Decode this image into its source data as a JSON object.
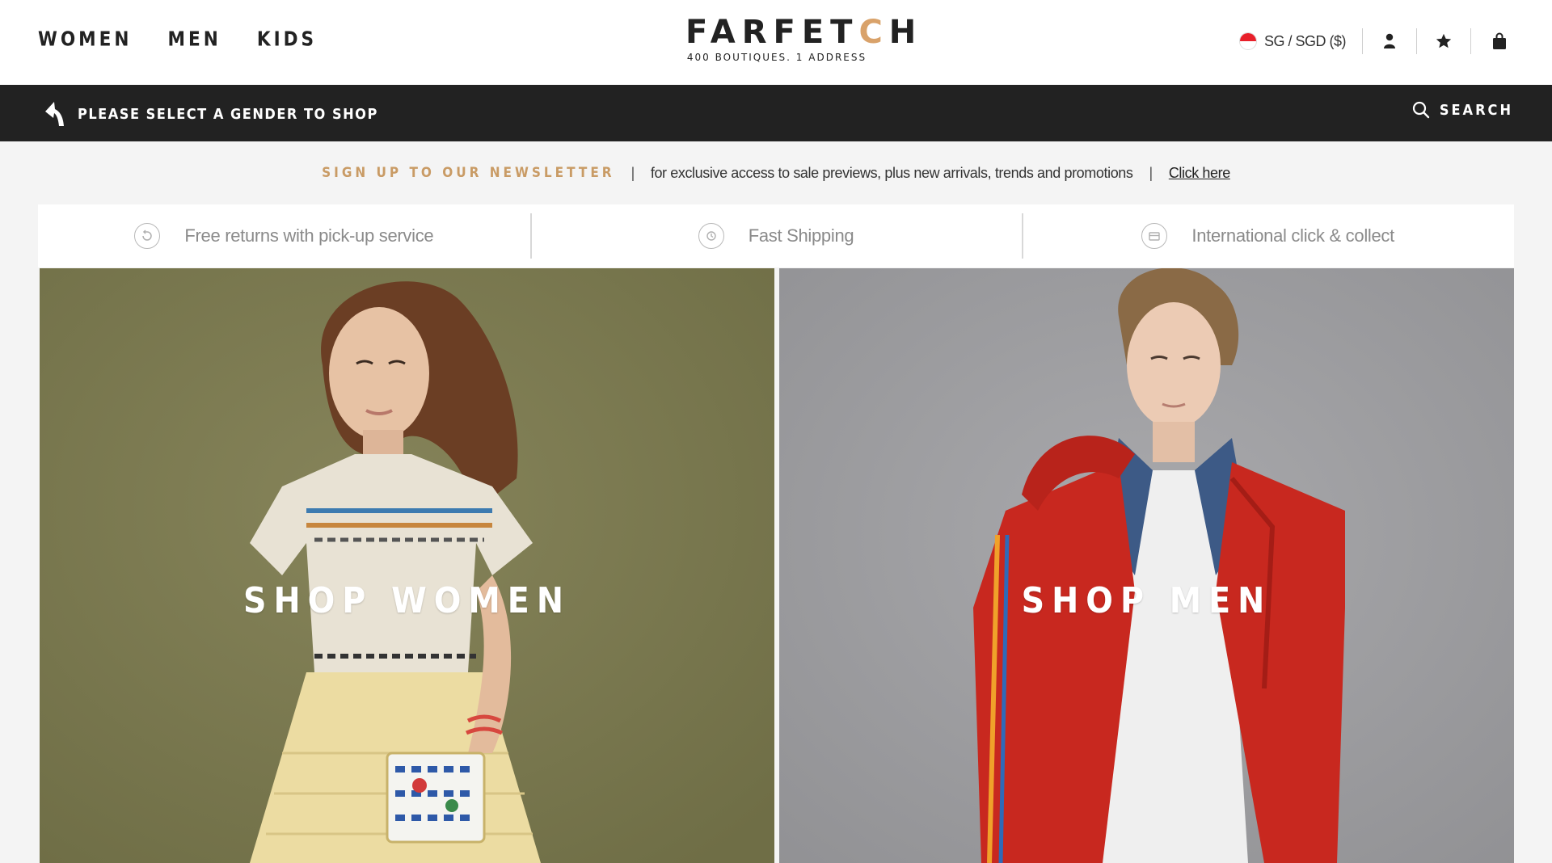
{
  "header": {
    "gender_nav": [
      "WOMEN",
      "MEN",
      "KIDS"
    ],
    "logo": {
      "wordmark_start": "FARFET",
      "wordmark_accent": "C",
      "wordmark_end": "H",
      "tagline": "400 BOUTIQUES. 1 ADDRESS"
    },
    "region": "SG / SGD ($)",
    "icons": [
      "flag-icon",
      "account-icon",
      "wishlist-icon",
      "bag-icon"
    ]
  },
  "black_bar": {
    "prompt": "PLEASE SELECT A GENDER TO SHOP",
    "search_label": "SEARCH"
  },
  "newsletter": {
    "signup": "SIGN UP TO OUR NEWSLETTER",
    "separator": "|",
    "description": "for exclusive access to sale previews, plus new arrivals, trends and promotions",
    "link": "Click here"
  },
  "usp": {
    "items": [
      {
        "label": "Free returns with pick-up service",
        "icon": "return-icon"
      },
      {
        "label": "Fast Shipping",
        "icon": "shipping-icon"
      },
      {
        "label": "International click & collect",
        "icon": "collect-icon"
      }
    ]
  },
  "tiles": {
    "women": "SHOP WOMEN",
    "men": "SHOP MEN"
  },
  "colors": {
    "accent_gold": "#c99b65",
    "dark_bar": "#222222",
    "women_bg": "#7b7a4f",
    "men_bg": "#9e9ea1"
  }
}
